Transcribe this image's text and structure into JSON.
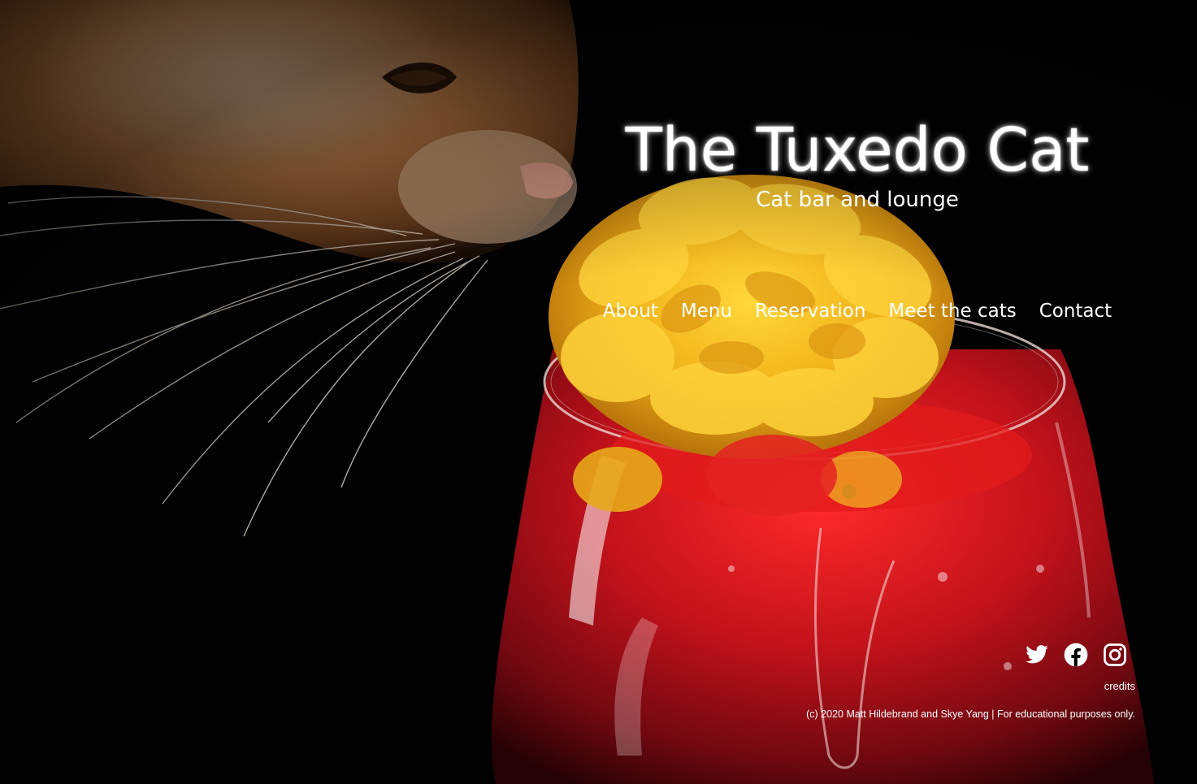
{
  "site": {
    "title": "The Tuxedo Cat",
    "tagline": "Cat bar and lounge"
  },
  "nav": {
    "items": [
      {
        "label": "About"
      },
      {
        "label": "Menu"
      },
      {
        "label": "Reservation"
      },
      {
        "label": "Meet the cats"
      },
      {
        "label": "Contact"
      }
    ]
  },
  "footer": {
    "social": [
      {
        "name": "twitter-icon"
      },
      {
        "name": "facebook-icon"
      },
      {
        "name": "instagram-icon"
      }
    ],
    "credits_label": "credits",
    "copyright": "(c) 2020 Matt Hildebrand and Skye Yang | For educational purposes only."
  },
  "colors": {
    "background": "#000000",
    "text": "#ffffff",
    "cat_fur": "#c8894f",
    "flower": "#f2b81c",
    "drink": "#c3121b"
  }
}
